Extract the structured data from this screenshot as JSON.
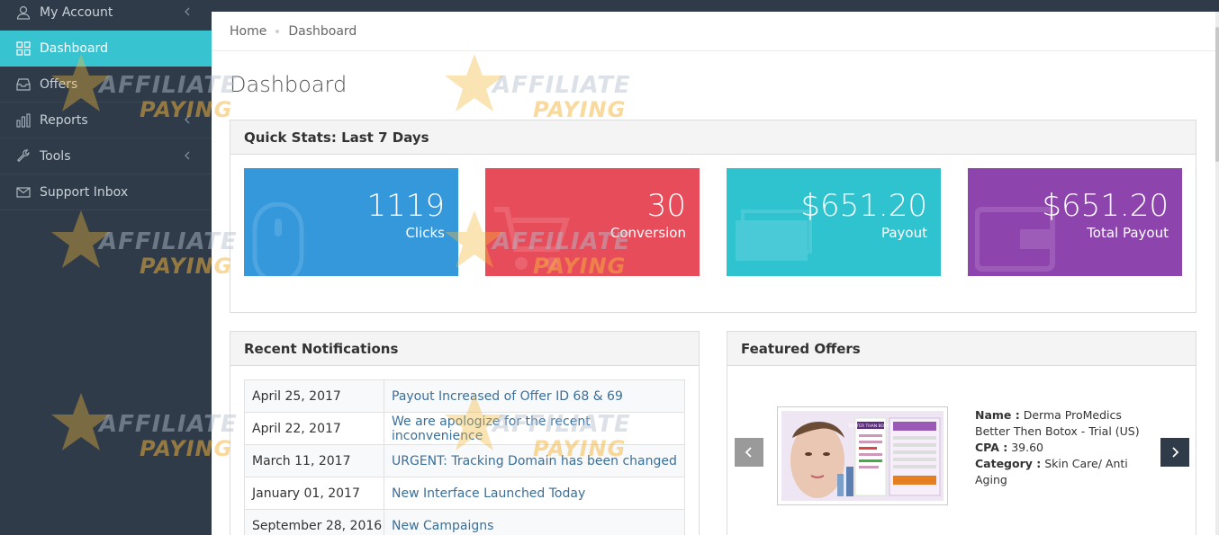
{
  "sidebar": {
    "items": [
      {
        "label": "My Account",
        "icon": "user-icon",
        "has_submenu": true
      },
      {
        "label": "Dashboard",
        "icon": "grid-icon",
        "active": true
      },
      {
        "label": "Offers",
        "icon": "inbox-icon"
      },
      {
        "label": "Reports",
        "icon": "bar-chart-icon",
        "has_submenu": true
      },
      {
        "label": "Tools",
        "icon": "wrench-icon",
        "has_submenu": true
      },
      {
        "label": "Support Inbox",
        "icon": "mail-icon"
      }
    ]
  },
  "breadcrumb": {
    "home": "Home",
    "current": "Dashboard"
  },
  "page": {
    "title": "Dashboard"
  },
  "quick_stats": {
    "title": "Quick Stats: Last 7 Days",
    "cards": [
      {
        "value": "1119",
        "label": "Clicks",
        "color": "#3498db",
        "icon": "mouse-icon"
      },
      {
        "value": "30",
        "label": "Conversion",
        "color": "#e74c5a",
        "icon": "cart-icon"
      },
      {
        "value": "$651.20",
        "label": "Payout",
        "color": "#2fc3d0",
        "icon": "money-icon"
      },
      {
        "value": "$651.20",
        "label": "Total Payout",
        "color": "#8e44ad",
        "icon": "wallet-icon"
      }
    ]
  },
  "notifications": {
    "title": "Recent Notifications",
    "rows": [
      {
        "date": "April 25, 2017",
        "message": "Payout Increased of Offer ID 68 & 69"
      },
      {
        "date": "April 22, 2017",
        "message": "We are apologize for the recent inconvenience"
      },
      {
        "date": "March 11, 2017",
        "message": "URGENT: Tracking Domain has been changed"
      },
      {
        "date": "January 01, 2017",
        "message": "New Interface Launched Today"
      },
      {
        "date": "September 28, 2016",
        "message": "New Campaigns"
      }
    ]
  },
  "featured": {
    "title": "Featured Offers",
    "offer": {
      "name_label": "Name :",
      "name": "Derma ProMedics Better Then Botox - Trial (US)",
      "cpa_label": "CPA :",
      "cpa": "39.60",
      "category_label": "Category :",
      "category": "Skin Care/ Anti Aging",
      "thumb_text": "BETTER THAN BOTOX"
    },
    "prev_icon": "chevron-left-icon",
    "next_icon": "chevron-right-icon"
  },
  "watermark": {
    "line1": "AFFILIATE",
    "line2": "PAYING"
  },
  "colors": {
    "sidebar": "#2f3b48",
    "accent": "#38c3d0",
    "link": "#3a6f9a"
  }
}
